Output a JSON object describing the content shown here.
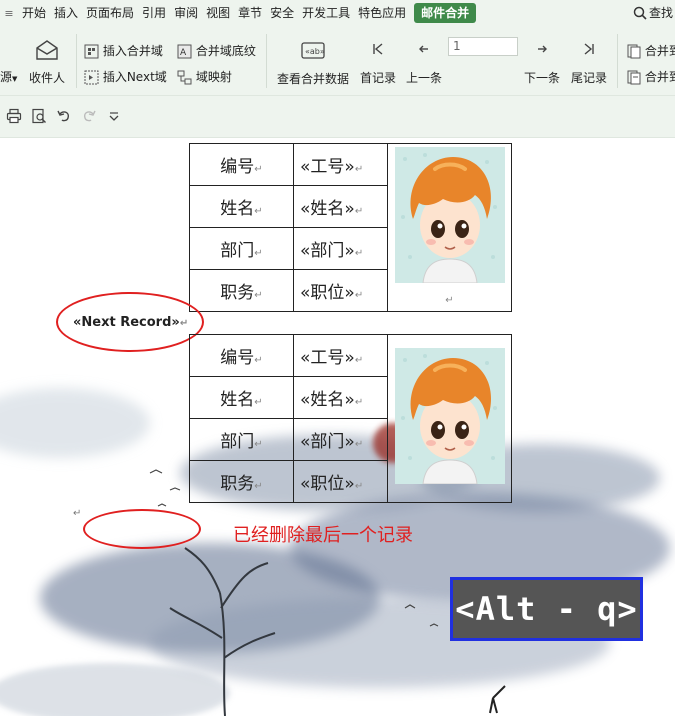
{
  "menubar": {
    "grip": "≡",
    "tabs": [
      "开始",
      "插入",
      "页面布局",
      "引用",
      "审阅",
      "视图",
      "章节",
      "安全",
      "开发工具",
      "特色应用"
    ],
    "active_tab": "邮件合并",
    "search_label": "查找"
  },
  "toolbar": {
    "source_label": "源",
    "recipients_label": "收件人",
    "insert_merge_field": "插入合并域",
    "insert_next_field": "插入Next域",
    "merge_field_shading": "合并域底纹",
    "field_mapping": "域映射",
    "view_merged_data": "查看合并数据",
    "first_record": "首记录",
    "prev_record": "上一条",
    "record_number": "1",
    "next_record": "下一条",
    "last_record": "尾记录",
    "merge_to_new_doc": "合并到",
    "merge_to_print": "合并到"
  },
  "records": [
    {
      "rows": [
        {
          "label": "编号",
          "value": "«工号»"
        },
        {
          "label": "姓名",
          "value": "«姓名»"
        },
        {
          "label": "部门",
          "value": "«部门»"
        },
        {
          "label": "职务",
          "value": "«职位»"
        }
      ]
    },
    {
      "rows": [
        {
          "label": "编号",
          "value": "«工号»"
        },
        {
          "label": "姓名",
          "value": "«姓名»"
        },
        {
          "label": "部门",
          "value": "«部门»"
        },
        {
          "label": "职务",
          "value": "«职位»"
        }
      ]
    }
  ],
  "document": {
    "next_record_field": "«Next Record»",
    "annotation": "已经删除最后一个记录",
    "paragraph_mark": "↵"
  },
  "hotkey": "<Alt - q>",
  "colors": {
    "ribbon_bg": "#eef4ee",
    "active_tab": "#3f8a4a",
    "annotation": "#e02020",
    "hotkey_border": "#2030e0",
    "hotkey_bg": "#555555"
  }
}
